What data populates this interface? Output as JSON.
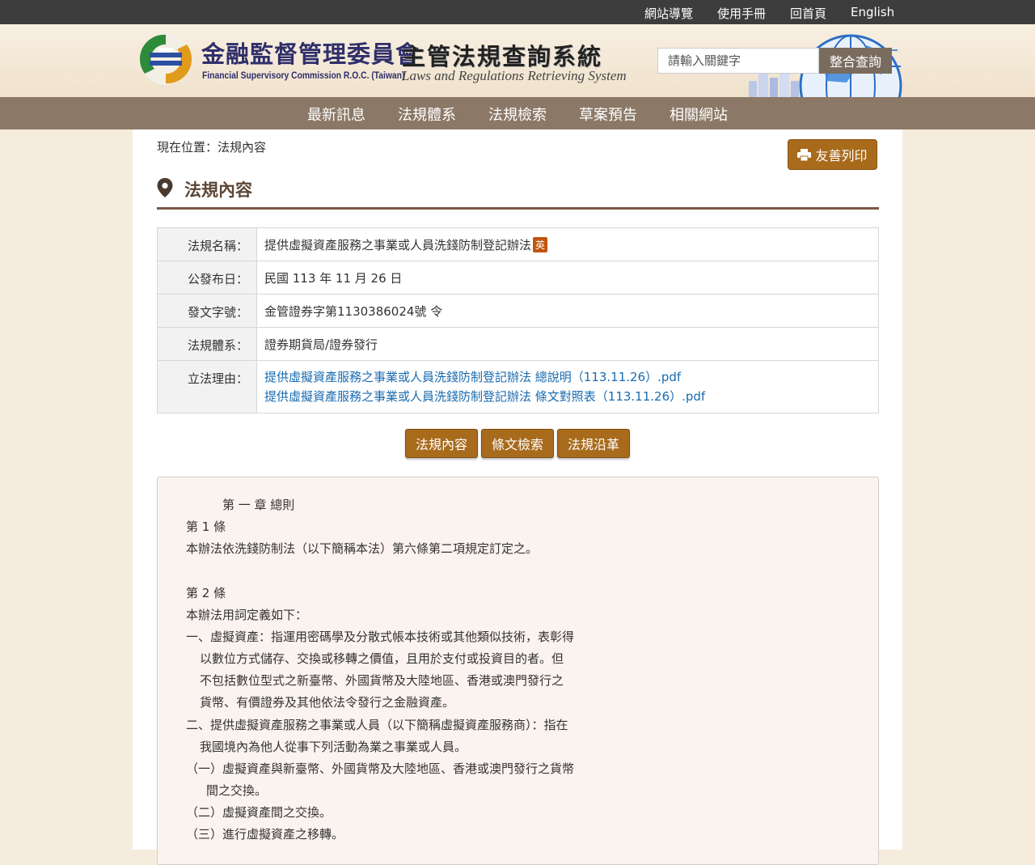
{
  "topbar": {
    "sitemap": "網站導覽",
    "manual": "使用手冊",
    "home": "回首頁",
    "english": "English"
  },
  "header": {
    "org_cn": "金融監督管理委員會",
    "org_en": "Financial Supervisory Commission R.O.C. (Taiwan)",
    "system_cn": "主管法規查詢系統",
    "system_en": "Laws and Regulations Retrieving System",
    "search_placeholder": "請輸入關鍵字",
    "search_button": "整合查詢"
  },
  "nav": [
    "最新訊息",
    "法規體系",
    "法規檢索",
    "草案預告",
    "相關網站"
  ],
  "breadcrumb": "現在位置：法規內容",
  "print_button": "友善列印",
  "section_title": "法規內容",
  "info": {
    "name_label": "法規名稱：",
    "name_value": "提供虛擬資產服務之事業或人員洗錢防制登記辦法",
    "english_badge": "英",
    "date_label": "公發布日：",
    "date_value": "民國 113 年 11 月 26 日",
    "doc_label": "發文字號：",
    "doc_value": "金管證券字第1130386024號 令",
    "system_label": "法規體系：",
    "system_value": "證券期貨局/證券發行",
    "reason_label": "立法理由：",
    "reason_links": [
      "提供虛擬資產服務之事業或人員洗錢防制登記辦法 總說明（113.11.26）.pdf",
      "提供虛擬資產服務之事業或人員洗錢防制登記辦法 條文對照表（113.11.26）.pdf"
    ]
  },
  "tabs": [
    "法規內容",
    "條文檢索",
    "法規沿革"
  ],
  "law_text": {
    "chapter": "第 一 章 總則",
    "art1_title": "第 1 條",
    "art1_body": "本辦法依洗錢防制法（以下簡稱本法）第六條第二項規定訂定之。",
    "art2_title": "第 2 條",
    "art2_intro": "本辦法用詞定義如下：",
    "item1_l1": "一、虛擬資產：指運用密碼學及分散式帳本技術或其他類似技術，表彰得",
    "item1_l2": "以數位方式儲存、交換或移轉之價值，且用於支付或投資目的者。但",
    "item1_l3": "不包括數位型式之新臺幣、外國貨幣及大陸地區、香港或澳門發行之",
    "item1_l4": "貨幣、有價證券及其他依法令發行之金融資產。",
    "item2_l1": "二、提供虛擬資產服務之事業或人員（以下簡稱虛擬資產服務商）：指在",
    "item2_l2": "我國境內為他人從事下列活動為業之事業或人員。",
    "sub1_l1": "（一）虛擬資產與新臺幣、外國貨幣及大陸地區、香港或澳門發行之貨幣",
    "sub1_l2": "間之交換。",
    "sub2": "（二）虛擬資產間之交換。",
    "sub3": "（三）進行虛擬資產之移轉。"
  },
  "colors": {
    "topbar": "#3d3d3d",
    "nav": "#8b7866",
    "accent_button": "#a86b1c",
    "link": "#1a6bb0",
    "page_background": "#f6ecdd"
  }
}
